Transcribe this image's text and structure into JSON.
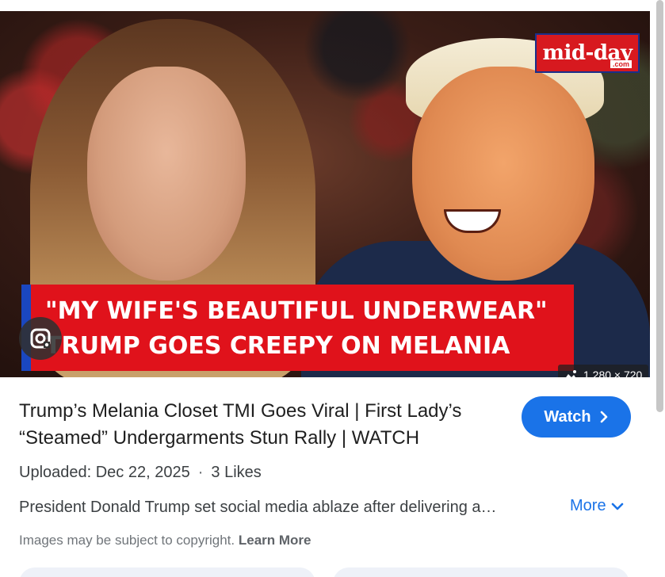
{
  "hero": {
    "logo_text": "mid-day",
    "logo_sub": ".com",
    "headline_line1": "\"MY WIFE'S BEAUTIFUL UNDERWEAR\"",
    "headline_line2": "TRUMP GOES CREEPY ON MELANIA",
    "dimensions": "1,280 × 720"
  },
  "result": {
    "title": "Trump’s Melania Closet TMI Goes Viral | First Lady’s “Steamed” Undergarments Stun Rally | WATCH",
    "watch_label": "Watch",
    "uploaded": "Uploaded: Dec 22, 2025",
    "separator": "·",
    "likes": "3 Likes",
    "description": "President Donald Trump set social media ablaze after delivering a…",
    "more_label": "More",
    "copyright_text": "Images may be subject to copyright.",
    "learn_more": "Learn More"
  },
  "colors": {
    "accent": "#1a73e8",
    "headline_red": "#e0121b",
    "headline_bar_blue": "#1a47c0"
  },
  "icons": {
    "lens": "google-lens-icon",
    "dims": "image-size-icon",
    "watch": "chevron-right-icon",
    "more": "chevron-down-icon"
  }
}
